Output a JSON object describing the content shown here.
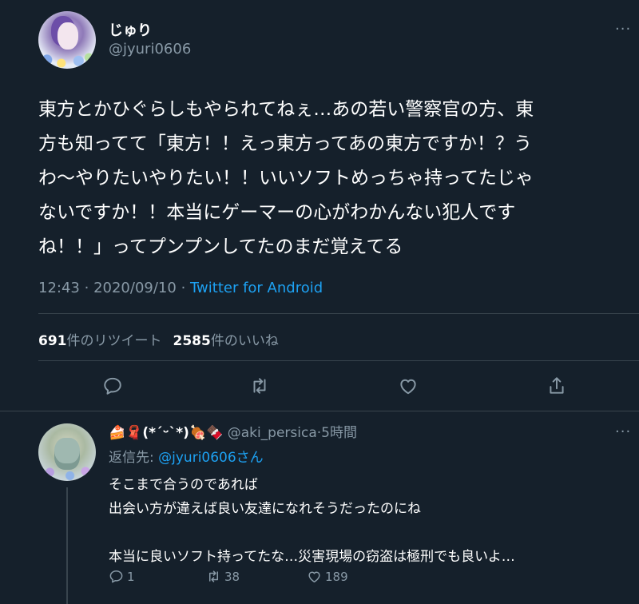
{
  "tweet": {
    "display_name": "じゅり",
    "handle": "@jyuri0606",
    "more": "···",
    "text_lines": [
      "東方とかひぐらしもやられてねぇ…あの若い警察官の方、東",
      "方も知ってて「東方！！えっ東方ってあの東方ですか！？う",
      "わ〜やりたいやりたい！！いいソフトめっちゃ持ってたじゃ",
      "ないですか！！本当にゲーマーの心がわかんない犯人です",
      "ね！！」ってプンプンしてたのまだ覚えてる"
    ],
    "time": "12:43",
    "sep1": "·",
    "date": "2020/09/10",
    "sep2": "·",
    "source": "Twitter for Android",
    "retweets_count": "691",
    "retweets_label": "件のリツイート",
    "likes_count": "2585",
    "likes_label": "件のいいね",
    "actions": [
      "reply-icon",
      "retweet-icon",
      "like-icon",
      "share-icon"
    ]
  },
  "reply": {
    "display_name": "🍰🧣(*ˊᵕˋ*)🍖🍫",
    "handle": "@aki_persica",
    "sep": "·",
    "time_ago": "5時間",
    "more": "···",
    "reply_to_prefix": "返信先: ",
    "reply_to_handle": "@jyuri0606さん",
    "text_lines": [
      "そこまで合うのであれば",
      "出会い方が違えば良い友達になれそうだったのにね",
      "",
      "本当に良いソフト持ってたな…災害現場の窃盗は極刑でも良いよ…"
    ],
    "reply_count": "1",
    "retweet_count": "38",
    "like_count": "189"
  },
  "colors": {
    "background": "#15202b",
    "text": "#ffffff",
    "secondary": "#8899a6",
    "accent": "#1da1f2",
    "divider": "#38444d"
  }
}
